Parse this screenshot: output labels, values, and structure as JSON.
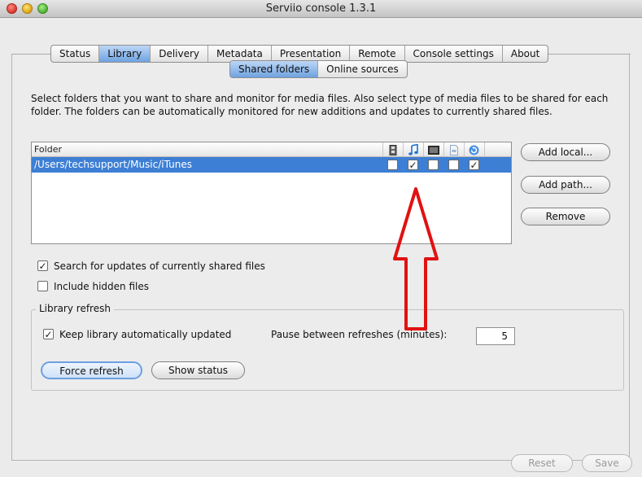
{
  "window": {
    "title": "Serviio console 1.3.1"
  },
  "tabs": [
    "Status",
    "Library",
    "Delivery",
    "Metadata",
    "Presentation",
    "Remote",
    "Console settings",
    "About"
  ],
  "active_tab": "Library",
  "subtabs": [
    "Shared folders",
    "Online sources"
  ],
  "active_subtab": "Shared folders",
  "description": "Select folders that you want to share and monitor for media files. Also select type of media files to be shared for each folder. The folders can be automatically monitored for new additions and updates to currently shared files.",
  "table": {
    "header": {
      "folder": "Folder",
      "icons": [
        "video-icon",
        "music-icon",
        "photo-icon",
        "document-icon",
        "refresh-icon"
      ]
    },
    "rows": [
      {
        "path": "/Users/techsupport/Music/iTunes",
        "checks": [
          false,
          true,
          false,
          false,
          true
        ]
      }
    ]
  },
  "buttons": {
    "add_local": "Add local...",
    "add_path": "Add path...",
    "remove": "Remove",
    "force_refresh": "Force refresh",
    "show_status": "Show status",
    "reset": "Reset",
    "save": "Save"
  },
  "options": {
    "search_updates": {
      "label": "Search for updates of currently shared files",
      "checked": true
    },
    "include_hidden": {
      "label": "Include hidden files",
      "checked": false
    }
  },
  "library_refresh": {
    "title": "Library refresh",
    "keep_updated": {
      "label": "Keep library automatically updated",
      "checked": true
    },
    "pause_label": "Pause between refreshes (minutes):",
    "pause_value": "5"
  },
  "colors": {
    "selection": "#3d7fd4",
    "annotation_arrow": "#e01212"
  }
}
